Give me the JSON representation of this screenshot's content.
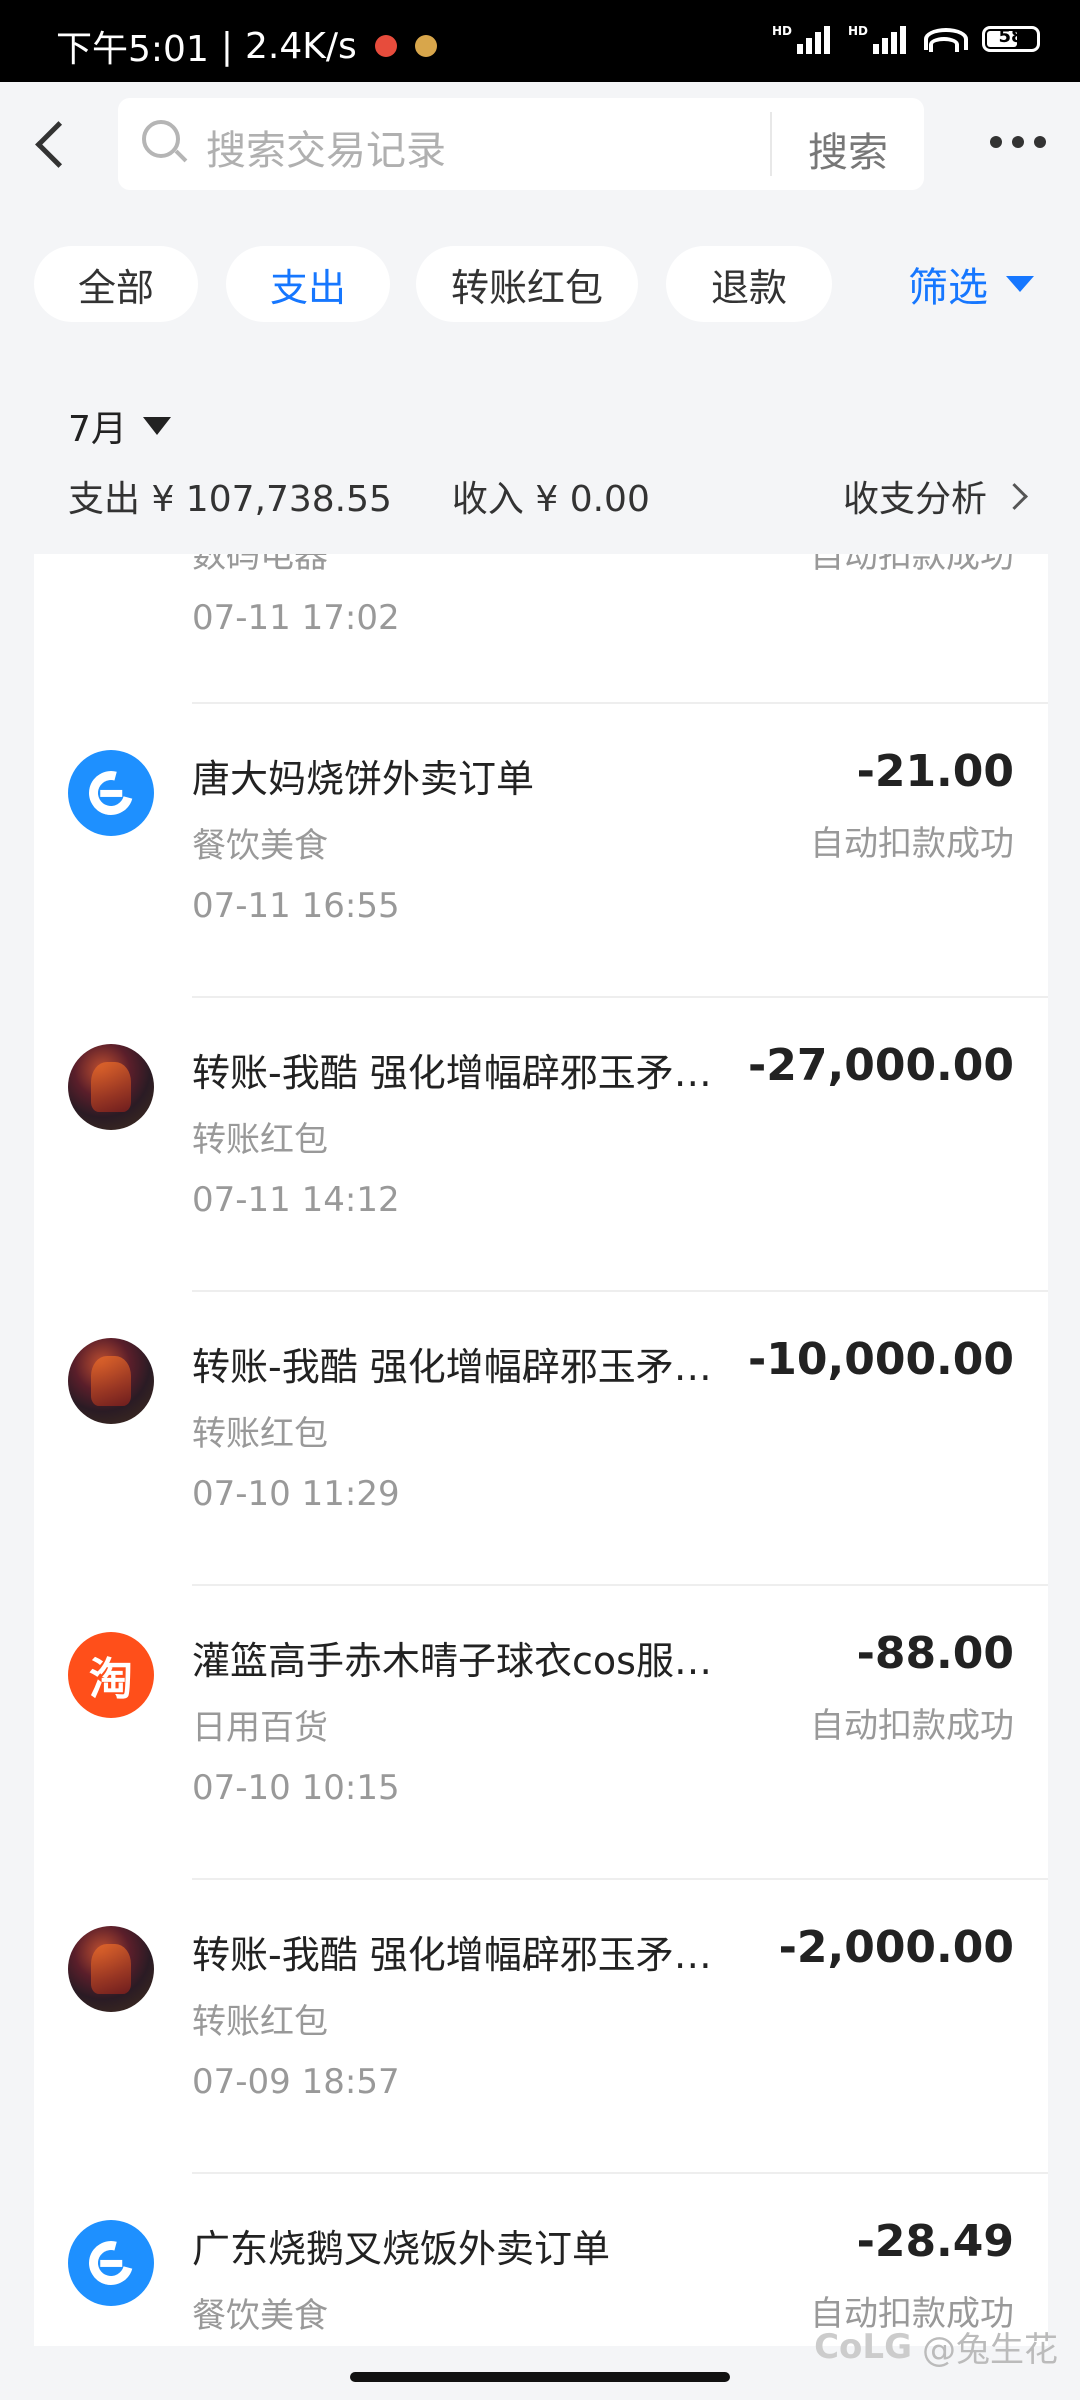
{
  "status_bar": {
    "time": "下午5:01",
    "net_speed": "2.4K/s",
    "sig1": "HD",
    "sig2": "HD",
    "battery": "58"
  },
  "header": {
    "search_placeholder": "搜索交易记录",
    "search_button": "搜索"
  },
  "chips": [
    "全部",
    "支出",
    "转账红包",
    "退款"
  ],
  "filter_label": "筛选",
  "month": "7月",
  "summary": {
    "expense": "支出 ¥ 107,738.55",
    "income": "收入 ¥ 0.00",
    "analysis": "收支分析"
  },
  "partial_row": {
    "category": "数码电器",
    "status": "自动扣款成功",
    "time": "07-11 17:02"
  },
  "transactions": [
    {
      "avatar": "ele",
      "title": "唐大妈烧饼外卖订单",
      "category": "餐饮美食",
      "time": "07-11 16:55",
      "amount": "-21.00",
      "status": "自动扣款成功"
    },
    {
      "avatar": "photo",
      "title": "转账-我酷 强化增幅辟邪玉矛…",
      "category": "转账红包",
      "time": "07-11 14:12",
      "amount": "-27,000.00",
      "status": ""
    },
    {
      "avatar": "photo",
      "title": "转账-我酷 强化增幅辟邪玉矛…",
      "category": "转账红包",
      "time": "07-10 11:29",
      "amount": "-10,000.00",
      "status": ""
    },
    {
      "avatar": "tao",
      "avatar_text": "淘",
      "title": "灌篮高手赤木晴子球衣cos服…",
      "category": "日用百货",
      "time": "07-10 10:15",
      "amount": "-88.00",
      "status": "自动扣款成功"
    },
    {
      "avatar": "photo",
      "title": "转账-我酷 强化增幅辟邪玉矛…",
      "category": "转账红包",
      "time": "07-09 18:57",
      "amount": "-2,000.00",
      "status": ""
    },
    {
      "avatar": "ele",
      "title": "广东烧鹅叉烧饭外卖订单",
      "category": "餐饮美食",
      "time": "",
      "amount": "-28.49",
      "status": "自动扣款成功"
    }
  ],
  "watermark": "@兔生花",
  "watermark_logo": "CoLG",
  "colors": {
    "accent": "#1677ff",
    "alipay_ele": "#1e90ff",
    "taobao": "#ff4f1a"
  }
}
